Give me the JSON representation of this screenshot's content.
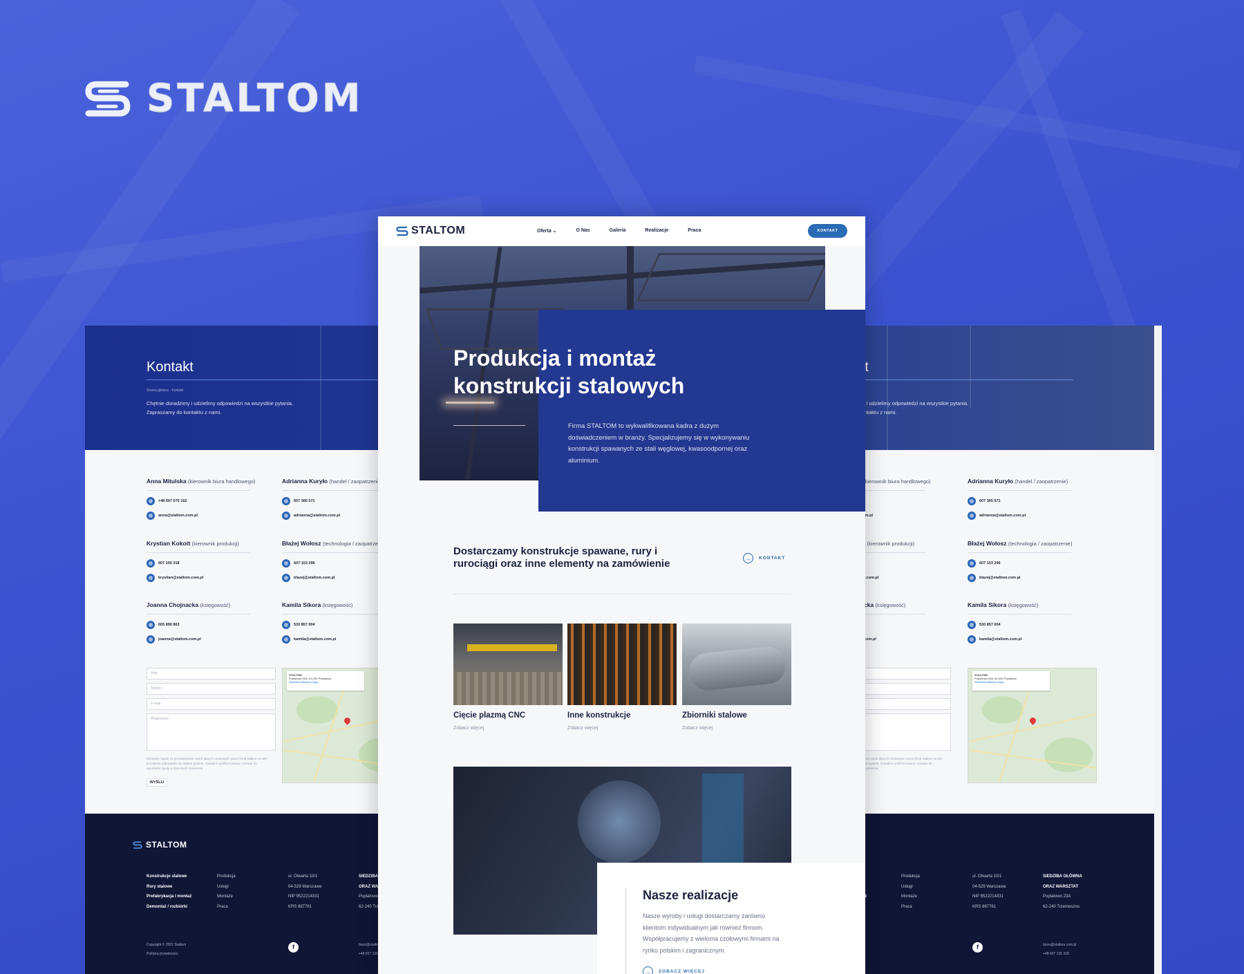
{
  "brand": {
    "name": "STALTOM"
  },
  "center": {
    "nav": {
      "logo": "STALTOM",
      "links": [
        "Oferta ⌄",
        "O Nas",
        "Galeria",
        "Realizacje",
        "Praca"
      ],
      "cta": "KONTAKT"
    },
    "hero": {
      "title": "Produkcja i montaż konstrukcji stalowych",
      "text": "Firma STALTOM to wykwalifikowana kadra z dużym doświadczeniem w branży. Specjalizujemy się w wykonywaniu konstrukcji spawanych ze stali węglowej, kwasoodpornej oraz aluminium."
    },
    "intro": {
      "heading": "Dostarczamy konstrukcje spawane, rury i rurociągi oraz inne elementy na zamówienie",
      "link": "KONTAKT"
    },
    "cards": [
      {
        "title": "Cięcie plazmą CNC",
        "more": "Zobacz więcej"
      },
      {
        "title": "Inne konstrukcje",
        "more": "Zobacz więcej"
      },
      {
        "title": "Zbiorniki stalowe",
        "more": "Zobacz więcej"
      }
    ],
    "realizations": {
      "title": "Nasze realizacje",
      "text": "Nasze wyroby i usługi dostarczamy zarówno klientom indywidualnym jak również firmom. Współpracujemy z wieloma czołowymi firmami na rynku polskim i zagranicznym.",
      "link": "ZOBACZ WIĘCEJ"
    }
  },
  "contact": {
    "title": "Kontakt",
    "breadcrumb": "Strona główna · Kontakt",
    "intro": "Chętnie doradzimy i udzielimy odpowiedzi na wszystkie pytania. Zapraszamy do kontaktu z nami.",
    "people": [
      {
        "name": "Anna Mitulska",
        "role": "(kierownik biura handlowego)",
        "phone": "+48 607 075 162",
        "email": "anna@staltom.com.pl"
      },
      {
        "name": "Adrianna Kuryło",
        "role": "(handel / zaopatrzenie)",
        "phone": "607 365 571",
        "email": "adrianna@staltom.com.pl"
      },
      {
        "name": "Krystian Kokott",
        "role": "(kierownik produkcji)",
        "phone": "607 155 318",
        "email": "krystian@staltom.com.pl"
      },
      {
        "name": "Błażej Wołosz",
        "role": "(technologia / zaopatrzenie)",
        "phone": "607 153 296",
        "email": "blazej@staltom.com.pl"
      },
      {
        "name": "Joanna Chojnacka",
        "role": "(księgowość)",
        "phone": "605 890 863",
        "email": "joanna@staltom.com.pl"
      },
      {
        "name": "Kamila Sikora",
        "role": "(księgowość)",
        "phone": "530 857 004",
        "email": "kamila@staltom.com.pl"
      }
    ],
    "form": {
      "name_ph": "Imię",
      "company_ph": "Telefon",
      "email_ph": "E-mail",
      "message_ph": "Wiadomość",
      "consent": "Wyrażam zgodę na przetwarzanie moich danych osobowych przez firmę Staltom w celu przesłania odpowiedzi na zadane pytanie. Zostałem poinformowany o prawie do wycofania zgody w dowolnym momencie.",
      "send": "WYŚLIJ"
    },
    "map": {
      "place": "STALTOM",
      "address": "Poplatowa 23A, 62-240 Poplatowo",
      "link": "Wyświetl większą mapę",
      "directions": "Wskazówki dojaz..."
    },
    "footer": {
      "logo": "STALTOM",
      "col1": [
        "Konstrukcje stalowe",
        "Rury stalowe",
        "Prefabrykacja i montaż",
        "Demontaż / rozbiórki"
      ],
      "col2": [
        "Produkcja",
        "Usługi",
        "Montaże",
        "Praca"
      ],
      "col3": [
        "ul. Otwarta 10/1",
        "04-529 Warszawa",
        "NIP 9522214331",
        "KRS 887761"
      ],
      "col4_title1": "SIEDZIBA GŁÓWNA",
      "col4_title2": "ORAZ WARSZTAT",
      "col4": [
        "Poplatowo 23A",
        "62-240 Trzemeszno"
      ],
      "copyright": "Copyright © 2022 Staltom",
      "privacy": "Polityka prywatności",
      "email": "biuro@staltom.com.pl",
      "phone": "+48 607 135 318",
      "fb": "f"
    }
  }
}
